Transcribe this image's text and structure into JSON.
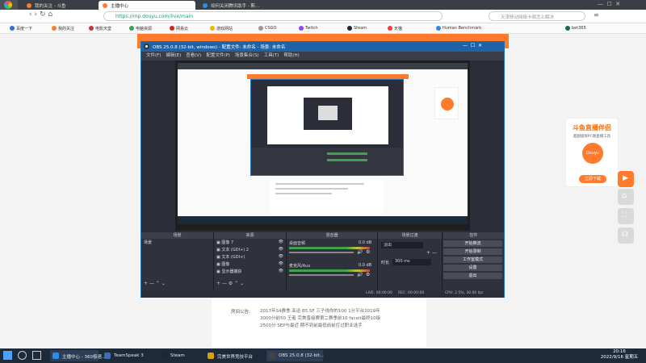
{
  "browser": {
    "tabs": [
      {
        "label": "我的关注 - 斗鱼",
        "active": false
      },
      {
        "label": "主播中心",
        "active": true
      },
      {
        "label": "如何关闭腾讯助手 - 斯...",
        "active": false
      }
    ],
    "url": "https://mp.douyu.com/live/main",
    "search_placeholder": "天津移动网络卡顿怎么解决",
    "bookmarks": [
      {
        "label": "百度一下",
        "color": "#2f6fe0"
      },
      {
        "label": "我的关注",
        "color": "#ff7a2a"
      },
      {
        "label": "电影天堂",
        "color": "#c33"
      },
      {
        "label": "电脑资源",
        "color": "#37a24f"
      },
      {
        "label": "网易云",
        "color": "#d22"
      },
      {
        "label": "游戏网站",
        "color": "#f4b400"
      },
      {
        "label": "CSGO",
        "color": "#999"
      },
      {
        "label": "Twitch",
        "color": "#9146ff"
      },
      {
        "label": "Steam",
        "color": "#1b2838"
      },
      {
        "label": "天猫",
        "color": "#ff3a3a"
      },
      {
        "label": "Human Benchmark",
        "color": "#2a8de8"
      },
      {
        "label": "bet365",
        "color": "#126e51"
      }
    ]
  },
  "obs": {
    "title": "OBS 25.0.8 (32-bit, windows) - 配置文件: 未命名 - 场景: 未命名",
    "menu": [
      "文件(F)",
      "编辑(E)",
      "查看(V)",
      "配置文件(P)",
      "场景集合(S)",
      "工具(T)",
      "帮助(H)"
    ],
    "docks": {
      "scenes": {
        "title": "场景",
        "items": [
          "场景"
        ]
      },
      "sources": {
        "title": "来源",
        "items": [
          "图像 7",
          "文本 (GDI+) 2",
          "文本 (GDI+)",
          "图像",
          "显示器捕获"
        ]
      },
      "mixer": {
        "title": "混音器",
        "items": [
          {
            "name": "桌面音频",
            "db": "0.0 dB"
          },
          {
            "name": "麦克风/Aux",
            "db": "0.0 dB"
          }
        ]
      },
      "transitions": {
        "title": "场景过渡",
        "fade": "淡出",
        "duration_label": "时长",
        "duration": "300 ms"
      },
      "controls": {
        "title": "控件",
        "buttons": [
          "开始推流",
          "开始录制",
          "工作室模式",
          "设置",
          "退出"
        ]
      }
    },
    "status": {
      "live": "LIVE: 00:00:00",
      "rec": "REC: 00:00:00",
      "cpu": "CPU: 2.5%, 30.00 fps"
    }
  },
  "page": {
    "notice_label": "房间公告:",
    "notice_text": "2017年S4赛季 亚运 B5 SF 三子线你的100 1分平台2019年 3000分前50 王者 完美晋级赛第二赛季前10 faceit最终10级 2500分 SEP与最近 期不到前最低前前打过职业选手"
  },
  "right_ad": {
    "title": "斗鱼直播伴侣",
    "subtitle": "超越极限PC端直播工具",
    "button": "立即下载",
    "brand": "Douyu"
  },
  "taskbar": {
    "items": [
      {
        "label": "主播中心 - 360极速...",
        "color": "#2a8de8"
      },
      {
        "label": "TeamSpeak 3",
        "color": "#3a6fb0"
      },
      {
        "label": "Steam",
        "color": "#1b2838"
      },
      {
        "label": "完美世界竞技平台",
        "color": "#d6a400"
      },
      {
        "label": "OBS 25.0.8 (32-bit...",
        "color": "#444"
      }
    ],
    "time": "20:16",
    "date": "2022/9/16 星期五"
  }
}
